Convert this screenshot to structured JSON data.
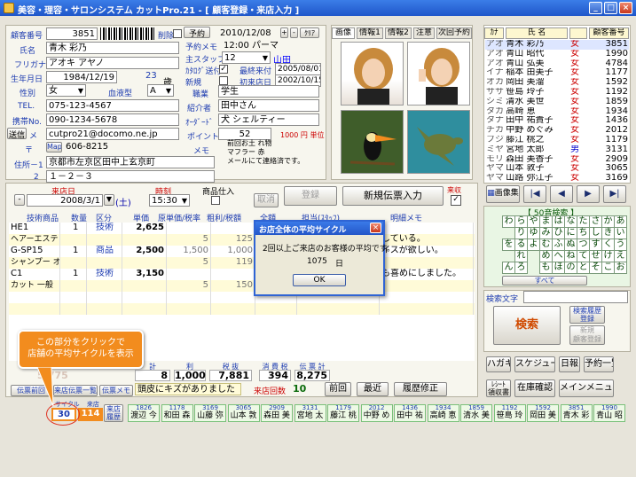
{
  "window": {
    "title": "美容・理容・サロンシステム カットPro.21 - [ 顧客登録・来店入力 ]",
    "min": "_",
    "max": "□",
    "close": "×"
  },
  "customer": {
    "no_label": "顧客番号",
    "no": "3851",
    "delete_label": "削除",
    "reserve_btn": "予約",
    "date": "2010/12/08",
    "plus": "+",
    "minus": "-",
    "clear_btn": "ｸﾘｱ",
    "name_label": "氏名",
    "name": "青木 彩乃",
    "reserve_memo_label": "予約メモ",
    "reserve_memo": "12:00 パーマ",
    "kana_label": "フリガナ",
    "kana": "アオキ アヤノ",
    "staff_label": "主スタッフ",
    "staff_no": "12",
    "staff_name": "山田",
    "birth_label": "生年月日",
    "birth": "1984/12/19",
    "age": "23",
    "age_unit": "歳",
    "dm_label": "ｶﾀﾛｸﾞ送付",
    "last_visit_label": "最終来付",
    "last_visit": "2005/08/01",
    "sex_label": "性別",
    "sex": "女",
    "blood_label": "血液型",
    "blood": "A",
    "new_label": "新規",
    "first_visit_label": "初来店日",
    "first_visit": "2002/10/15",
    "tel_label": "TEL.",
    "tel": "075-123-4567",
    "job_label": "職業",
    "job": "学生",
    "mobile_label": "携帯No.",
    "mobile": "090-1234-5678",
    "intro_label": "紹介者",
    "intro": "田中さん",
    "mail_send": "送信",
    "mail_label": "メ",
    "mail": "cutpro21@docomo.ne.jp",
    "order_label": "ｵｰﾀﾞｰﾄﾞ",
    "order": "犬 シェルティー",
    "zip_label": "〒",
    "map_btn": "Map",
    "zip": "606-8215",
    "point_label": "ポイント",
    "point": "52",
    "point_unit": "1000 円 単位",
    "addr1_label": "住所－1",
    "addr1": "京都市左京区田中上玄京町",
    "memo_label": "メモ",
    "memo": "前回お土 れ物\nマフラー 赤\nメールにて連絡済です。",
    "addr2_label": "2",
    "addr2": "１－２－３"
  },
  "photos": {
    "tabs": [
      "画像",
      "情報1",
      "情報2",
      "注意",
      "次回予約"
    ]
  },
  "list": {
    "headers": [
      "ｶﾅ",
      "氏 名",
      "",
      "顧客番号"
    ],
    "rows": [
      [
        "アオ",
        "青木 彩乃",
        "女",
        "3851"
      ],
      [
        "アオ",
        "青山 昭代",
        "女",
        "1990"
      ],
      [
        "アオ",
        "青山 弘美",
        "女",
        "4784"
      ],
      [
        "イナ",
        "稲本 由美子",
        "女",
        "1177"
      ],
      [
        "オカ",
        "岡田 美溜",
        "女",
        "1592"
      ],
      [
        "ササ",
        "笹島 玲子",
        "女",
        "1192"
      ],
      [
        "シミ",
        "清水 美世",
        "女",
        "1859"
      ],
      [
        "タカ",
        "高崎 恵",
        "女",
        "1934"
      ],
      [
        "タナ",
        "田中 祐貴子",
        "女",
        "1436"
      ],
      [
        "チカ",
        "中野 めぐみ",
        "女",
        "2012"
      ],
      [
        "フジ",
        "藤江 桃之",
        "女",
        "1179"
      ],
      [
        "ミヤ",
        "宮地 太郎",
        "男",
        "3131"
      ],
      [
        "モリ",
        "森田 美香子",
        "女",
        "2909"
      ],
      [
        "ヤマ",
        "山本 敦子",
        "女",
        "3065"
      ],
      [
        "ヤマ",
        "山路 弥江子",
        "女",
        "3169"
      ]
    ],
    "image_btn": "画像集",
    "first": "|◀",
    "prev": "◀",
    "next": "▶",
    "last": "▶|"
  },
  "kana": {
    "title": "【 50音検索 】",
    "rows": [
      [
        "わ",
        "ら",
        "や",
        "ま",
        "は",
        "な",
        "た",
        "さ",
        "か",
        "あ"
      ],
      [
        "",
        "り",
        "ゆ",
        "み",
        "ひ",
        "に",
        "ち",
        "し",
        "き",
        "い"
      ],
      [
        "を",
        "る",
        "よ",
        "む",
        "ふ",
        "ぬ",
        "つ",
        "す",
        "く",
        "う"
      ],
      [
        "",
        "れ",
        "",
        "め",
        "へ",
        "ね",
        "て",
        "せ",
        "け",
        "え"
      ],
      [
        "ん",
        "ろ",
        "",
        "も",
        "ほ",
        "の",
        "と",
        "そ",
        "こ",
        "お"
      ]
    ],
    "all": "すべて",
    "search_label": "検索文字",
    "search_btn": "検索",
    "history_btn": "検索履歴\n登録",
    "new_btn": "新規\n顧客登録"
  },
  "sales": {
    "date_label": "来店日",
    "date": "2008/3/1",
    "dow": "(土)",
    "time_label": "時刻",
    "time": "15:30",
    "product_label": "商品仕入",
    "cancel_btn": "取消",
    "register_btn": "登録",
    "new_btn": "新規伝票入力",
    "done_label": "来収",
    "headers": [
      "技術商品",
      "数量",
      "区分",
      "単価",
      "原単価/税率",
      "粗利/税額",
      "全額",
      "担当(ｽﾀｯﾌ)",
      "明細メモ"
    ],
    "rows": [
      {
        "code": "HE1",
        "qty": "1",
        "cat": "技術",
        "price": "2,625",
        "cost": "",
        "profit": "",
        "amount": "",
        "staff": "",
        "memo": ""
      },
      {
        "code": "ヘアーエステ ショート",
        "qty": "",
        "cat": "",
        "price": "",
        "cost": "5",
        "profit": "125",
        "amount": "",
        "staff": "",
        "memo": "している。"
      },
      {
        "code": "G-SP15",
        "qty": "1",
        "cat": "商品",
        "price": "2,500",
        "cost": "1,500",
        "profit": "1,000",
        "amount": "",
        "staff": "",
        "memo": "イスが欲しい。"
      },
      {
        "code": "シャンプー オリジナル",
        "qty": "",
        "cat": "",
        "price": "",
        "cost": "5",
        "profit": "119",
        "amount": "",
        "staff": "",
        "memo": ""
      },
      {
        "code": "C1",
        "qty": "1",
        "cat": "技術",
        "price": "3,150",
        "cost": "",
        "profit": "",
        "amount": "",
        "staff": "",
        "memo": "も喜めにしました。"
      },
      {
        "code": "カット 一般",
        "qty": "",
        "cat": "",
        "price": "",
        "cost": "5",
        "profit": "150",
        "amount": "",
        "staff": "",
        "memo": ""
      }
    ],
    "totals_labels": [
      "計",
      "利",
      "税 抜",
      "消 費 税",
      "伝 票 計"
    ],
    "totals": [
      "8",
      "1,000",
      "7,881",
      "394",
      "8,275"
    ],
    "faint_left": "5,775",
    "left_btn1": "伝票前回",
    "left_btn2": "来店伝票一覧",
    "left_btn3": "伝票メモ",
    "note": "頭皮にキズがありました",
    "visits_label": "来店回数",
    "visits": "10",
    "prev": "前回",
    "latest": "最近",
    "history": "履歴修正"
  },
  "side": {
    "btns": [
      "ハガキ",
      "スケジュール",
      "日報",
      "予約一覧",
      "ﾚｼｰﾄ\n領収書",
      "在庫確認",
      "メインメニュー"
    ]
  },
  "cycle": {
    "label1": "サイクル",
    "label2": "来店回",
    "value1": "30",
    "value2": "114",
    "visit_history": "来店\n履歴",
    "callout": "この部分をクリックで\n店舗の平均サイクルを表示",
    "recent": [
      [
        "1826",
        "渡辺 今"
      ],
      [
        "1178",
        "和田 森"
      ],
      [
        "3169",
        "山藤 弥"
      ],
      [
        "3065",
        "山本 敦"
      ],
      [
        "2909",
        "森田 美"
      ],
      [
        "3131",
        "宮地 太"
      ],
      [
        "1179",
        "藤江 桃"
      ],
      [
        "2012",
        "中野 め"
      ],
      [
        "1436",
        "田中 祐"
      ],
      [
        "1934",
        "高崎 恵"
      ],
      [
        "1859",
        "清水 美"
      ],
      [
        "1192",
        "笹島 玲"
      ],
      [
        "1592",
        "岡田 美"
      ],
      [
        "3851",
        "青木 彩"
      ],
      [
        "1990",
        "青山 昭"
      ]
    ]
  },
  "dialog": {
    "title": "お店全体の平均サイクル",
    "close": "×",
    "message": "2回以上ご来店のお客様の平均です。",
    "value": "1075",
    "unit": "日",
    "ok": "OK"
  },
  "colors": {
    "title_bar": "#2b63d8",
    "accent_orange": "#f28c1e",
    "dialog_blue": "#2f64d4",
    "kana_green": "#e9f6e4"
  }
}
